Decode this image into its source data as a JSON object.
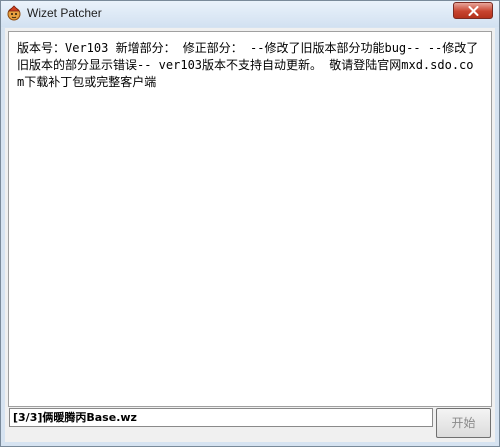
{
  "window": {
    "title": "Wizet Patcher"
  },
  "icons": {
    "app": "app-icon",
    "close": "close-icon"
  },
  "notice": {
    "text": "版本号：Ver103 新增部分： 修正部分： --修改了旧版本部分功能bug-- --修改了旧版本的部分显示错误-- ver103版本不支持自动更新。 敬请登陆官网mxd.sdo.com下载补丁包或完整客户端"
  },
  "status": {
    "progress_text": "[3/3]俩暖腾丙Base.wz"
  },
  "actions": {
    "start_label": "开始"
  },
  "colors": {
    "titlebar": "#d6e3f1",
    "close_button": "#c8442f",
    "client_background": "#f0f0f0"
  }
}
